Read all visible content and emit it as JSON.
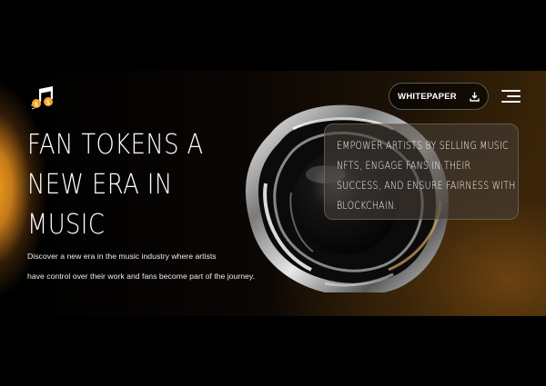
{
  "header": {
    "logo_icon": "music-note-coin-icon",
    "whitepaper_label": "WHITEPAPER",
    "download_icon": "download-icon",
    "menu_icon": "hamburger-menu-icon"
  },
  "hero": {
    "title": "FAN TOKENS A NEW ERA IN MUSIC",
    "description_line1": "Discover a new era in the music industry where artists",
    "description_line2": "have control over their work and fans become part of the journey."
  },
  "card": {
    "text": "EMPOWER ARTISTS BY SELLING MUSIC NFTS, ENGAGE FANS IN THEIR SUCCESS, AND ENSURE FAIRNESS WITH BLOCKCHAIN."
  },
  "colors": {
    "accent_orange": "#f0a21c",
    "coin_gold": "#f4a62a",
    "background": "#000000"
  }
}
